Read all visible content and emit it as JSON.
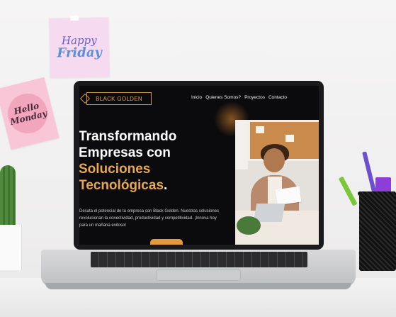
{
  "notes": {
    "friday_line1": "Happy",
    "friday_line2": "Friday",
    "monday_line1": "Hello",
    "monday_line2": "Monday"
  },
  "website": {
    "logo_text": "BLACK GOLDEN",
    "nav": [
      "Inicio",
      "Quienes Somos?",
      "Proyectos",
      "Contacto"
    ],
    "headline_line1": "Transformando",
    "headline_line2": "Empresas con",
    "headline_highlight1": "Soluciones",
    "headline_highlight2": "Tecnológicas",
    "headline_period": ".",
    "description": "Desata el potencial de tu empresa con Black Golden. Nuestras soluciones revolucionan la conectividad, productividad y competitividad. ¡Innova hoy para un mañana exitoso!",
    "accent_color": "#e8a84f",
    "background_color": "#0b0b0d"
  }
}
